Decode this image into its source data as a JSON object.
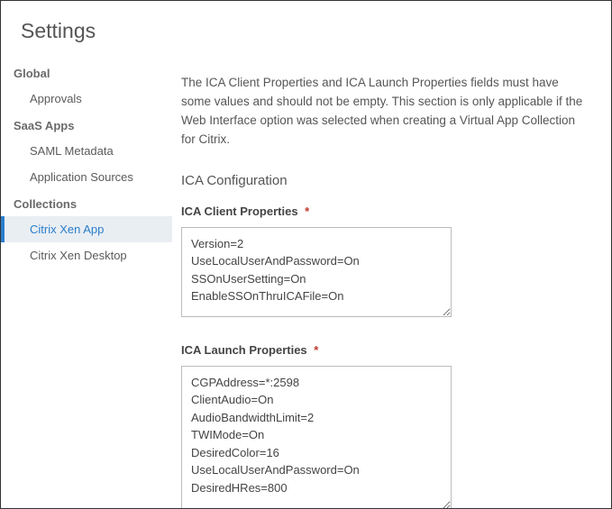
{
  "header": {
    "title": "Settings"
  },
  "sidebar": {
    "sections": [
      {
        "title": "Global",
        "items": [
          {
            "label": "Approvals",
            "name": "nav-approvals",
            "active": false
          }
        ]
      },
      {
        "title": "SaaS Apps",
        "items": [
          {
            "label": "SAML Metadata",
            "name": "nav-saml-metadata",
            "active": false
          },
          {
            "label": "Application Sources",
            "name": "nav-application-sources",
            "active": false
          }
        ]
      },
      {
        "title": "Collections",
        "items": [
          {
            "label": "Citrix Xen App",
            "name": "nav-citrix-xen-app",
            "active": true
          },
          {
            "label": "Citrix Xen Desktop",
            "name": "nav-citrix-xen-desktop",
            "active": false
          }
        ]
      }
    ]
  },
  "main": {
    "intro": "The ICA Client Properties and ICA Launch Properties fields must have some values and should not be empty. This section is only applicable if the Web Interface option was selected when creating a Virtual App Collection for Citrix.",
    "section_title": "ICA Configuration",
    "fields": {
      "ica_client": {
        "label": "ICA Client Properties",
        "required_marker": "*",
        "value": "Version=2\nUseLocalUserAndPassword=On\nSSOnUserSetting=On\nEnableSSOnThruICAFile=On"
      },
      "ica_launch": {
        "label": "ICA Launch Properties",
        "required_marker": "*",
        "value": "CGPAddress=*:2598\nClientAudio=On\nAudioBandwidthLimit=2\nTWIMode=On\nDesiredColor=16\nUseLocalUserAndPassword=On\nDesiredHRes=800"
      }
    }
  }
}
